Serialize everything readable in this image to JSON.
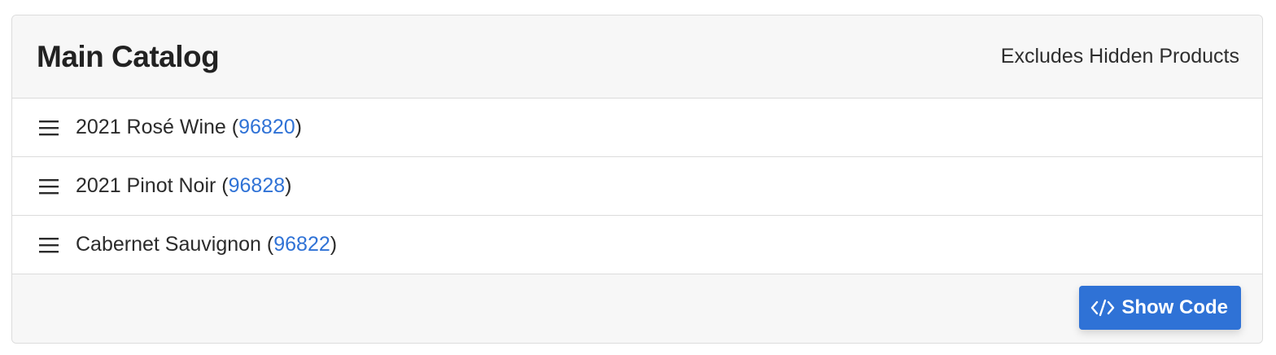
{
  "header": {
    "title": "Main Catalog",
    "note": "Excludes Hidden Products"
  },
  "items": [
    {
      "name": "2021 Rosé Wine",
      "id": "96820",
      "icon": "drag-handle-icon"
    },
    {
      "name": "2021 Pinot Noir",
      "id": "96828",
      "icon": "drag-handle-icon"
    },
    {
      "name": "Cabernet Sauvignon",
      "id": "96822",
      "icon": "drag-handle-icon"
    }
  ],
  "footer": {
    "show_code_label": "Show Code",
    "show_code_icon": "code-icon"
  },
  "colors": {
    "link": "#2f72d6",
    "button": "#2f72d6",
    "panel_bg": "#f7f7f7",
    "border": "#dcdcdc"
  }
}
